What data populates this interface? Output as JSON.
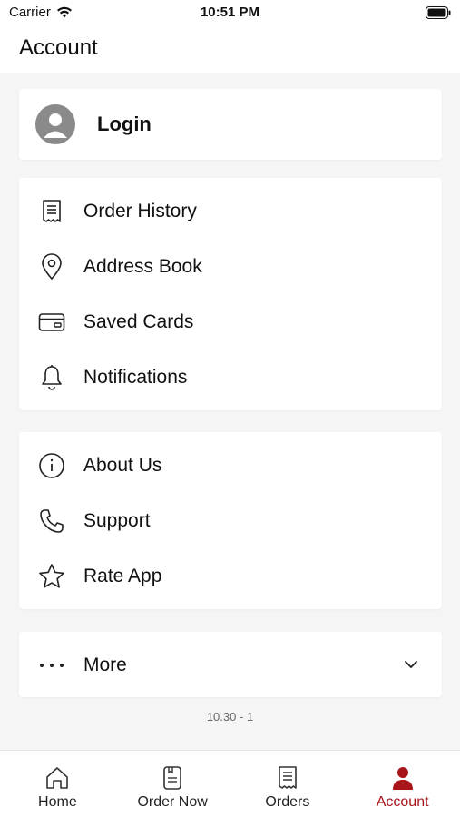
{
  "status_bar": {
    "carrier": "Carrier",
    "time": "10:51 PM"
  },
  "header": {
    "title": "Account"
  },
  "login": {
    "label": "Login"
  },
  "menu_group_1": [
    {
      "label": "Order History",
      "icon": "receipt-icon"
    },
    {
      "label": "Address Book",
      "icon": "location-pin-icon"
    },
    {
      "label": "Saved Cards",
      "icon": "credit-card-icon"
    },
    {
      "label": "Notifications",
      "icon": "bell-icon"
    }
  ],
  "menu_group_2": [
    {
      "label": "About Us",
      "icon": "info-icon"
    },
    {
      "label": "Support",
      "icon": "phone-icon"
    },
    {
      "label": "Rate App",
      "icon": "star-icon"
    }
  ],
  "more": {
    "label": "More",
    "icon": "ellipsis-icon",
    "expanded": false
  },
  "version": "10.30 - 1",
  "tab_bar": {
    "tabs": [
      {
        "label": "Home",
        "icon": "home-icon",
        "active": false
      },
      {
        "label": "Order Now",
        "icon": "order-icon",
        "active": false
      },
      {
        "label": "Orders",
        "icon": "receipt-icon",
        "active": false
      },
      {
        "label": "Account",
        "icon": "person-icon",
        "active": true
      }
    ]
  },
  "colors": {
    "accent": "#a8161b",
    "background": "#f5f5f5",
    "card": "#ffffff",
    "avatar": "#8a8a8a"
  }
}
